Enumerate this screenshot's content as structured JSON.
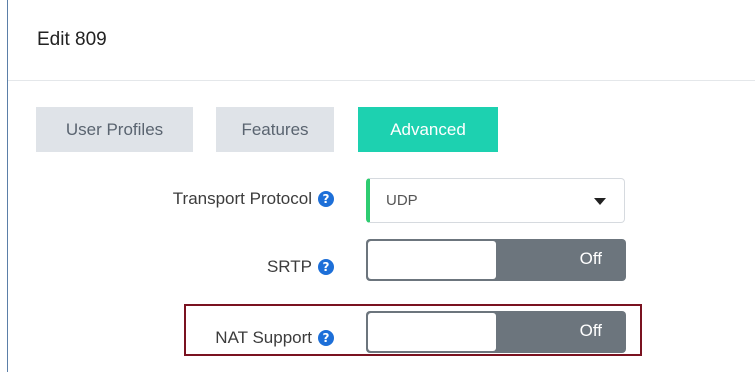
{
  "dialog": {
    "title": "Edit 809"
  },
  "tabs": [
    {
      "label": "User Profiles",
      "active": false
    },
    {
      "label": "Features",
      "active": false
    },
    {
      "label": "Advanced",
      "active": true
    }
  ],
  "fields": {
    "transport_protocol": {
      "label": "Transport Protocol",
      "value": "UDP",
      "help_icon": "question-circle-icon"
    },
    "srtp": {
      "label": "SRTP",
      "state": "Off",
      "help_icon": "question-circle-icon"
    },
    "nat_support": {
      "label": "NAT Support",
      "state": "Off",
      "help_icon": "question-circle-icon",
      "highlighted": true
    }
  },
  "colors": {
    "active_tab": "#1dd1b0",
    "inactive_tab": "#dfe3e8",
    "help_icon": "#1d6fd8",
    "toggle_off": "#6c757d",
    "select_accent": "#2ecc71",
    "highlight_border": "#7a1220"
  },
  "glyphs": {
    "help": "?"
  }
}
